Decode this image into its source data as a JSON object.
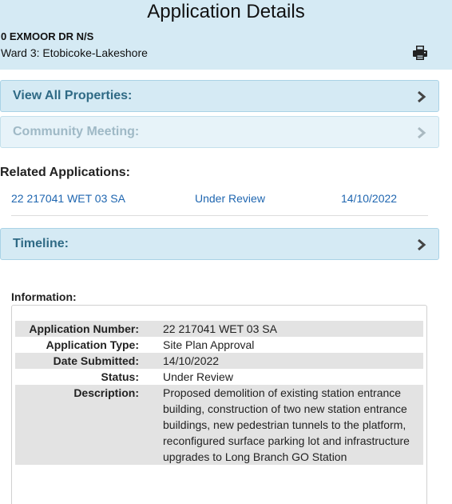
{
  "header": {
    "title": "Application Details",
    "address": "0 EXMOOR DR N/S",
    "ward": "Ward 3: Etobicoke-Lakeshore",
    "print_icon": "printer-icon"
  },
  "accordions": {
    "view_all_properties": "View All Properties:",
    "community_meeting": "Community Meeting:",
    "timeline": "Timeline:"
  },
  "related": {
    "heading": "Related Applications:",
    "rows": [
      {
        "number": "22 217041 WET 03 SA",
        "status": "Under Review",
        "date": "14/10/2022"
      }
    ]
  },
  "information": {
    "heading": "Information:",
    "rows": [
      {
        "label": "Application Number:",
        "value": "22 217041 WET 03 SA"
      },
      {
        "label": "Application Type:",
        "value": "Site Plan Approval"
      },
      {
        "label": "Date Submitted:",
        "value": "14/10/2022"
      },
      {
        "label": "Status:",
        "value": "Under Review"
      },
      {
        "label": "Description:",
        "value": "Proposed demolition of existing station entrance building, construction of two new station entrance buildings, new pedestrian tunnels to the platform, reconfigured surface parking lot and infrastructure upgrades to Long Branch GO Station"
      }
    ]
  },
  "colors": {
    "panel_bg": "#d5eaf4",
    "accordion_text": "#2f6a85",
    "link": "#1f66b0",
    "row_shade": "#e3e3e3"
  }
}
